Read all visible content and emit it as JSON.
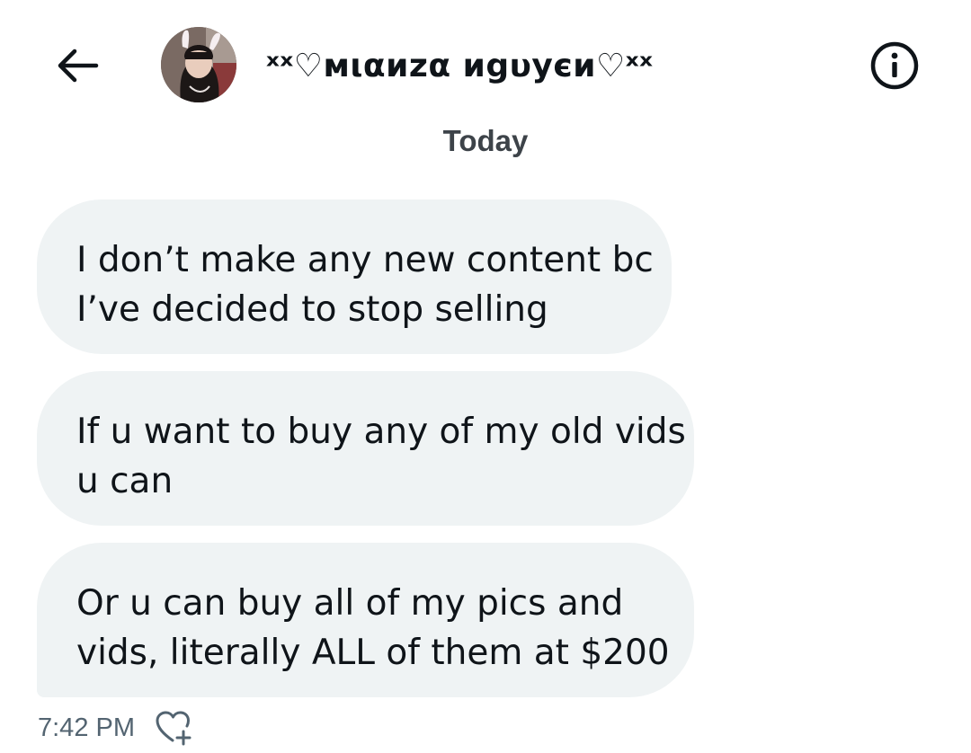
{
  "header": {
    "contact_name": "ˣˣ♡ᴍιαиzα иgυуєи♡ˣˣ",
    "back_icon": "arrow-left-icon",
    "info_icon": "info-circle-icon",
    "avatar_icon": "profile-photo"
  },
  "conversation": {
    "date_divider": "Today",
    "messages": [
      {
        "lines": [
          "I don’t make any new content bc",
          "I’ve decided to stop selling"
        ]
      },
      {
        "lines": [
          "If u want to buy any of my old vids",
          "u can"
        ]
      },
      {
        "lines": [
          "Or u can buy all of my pics and",
          "vids, literally ALL of them at $200"
        ]
      }
    ],
    "timestamp": "7:42 PM",
    "react_icon": "heart-plus-icon"
  },
  "colors": {
    "bubble_bg": "#eff3f4",
    "text_primary": "#0f1419",
    "text_secondary": "#536471"
  }
}
